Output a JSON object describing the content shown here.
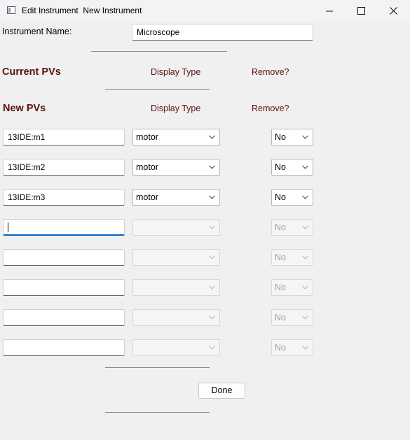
{
  "window": {
    "title": "Edit Instrument  New Instrument",
    "icon": "app-window-icon"
  },
  "form": {
    "name_label": "Instrument Name:",
    "name_value": "Microscope",
    "current_pvs_header": "Current PVs",
    "new_pvs_header": "New PVs",
    "display_type_header": "Display Type",
    "remove_header": "Remove?",
    "done_label": "Done"
  },
  "new_pvs": [
    {
      "pv": "13IDE:m1",
      "display_type": "motor",
      "remove": "No",
      "enabled": true
    },
    {
      "pv": "13IDE:m2",
      "display_type": "motor",
      "remove": "No",
      "enabled": true
    },
    {
      "pv": "13IDE:m3",
      "display_type": "motor",
      "remove": "No",
      "enabled": true
    },
    {
      "pv": "",
      "display_type": "",
      "remove": "No",
      "enabled": false,
      "focused": true
    },
    {
      "pv": "",
      "display_type": "",
      "remove": "No",
      "enabled": false
    },
    {
      "pv": "",
      "display_type": "",
      "remove": "No",
      "enabled": false
    },
    {
      "pv": "",
      "display_type": "",
      "remove": "No",
      "enabled": false
    },
    {
      "pv": "",
      "display_type": "",
      "remove": "No",
      "enabled": false
    }
  ],
  "colors": {
    "header": "#5a1010",
    "focus": "#0067c0"
  }
}
